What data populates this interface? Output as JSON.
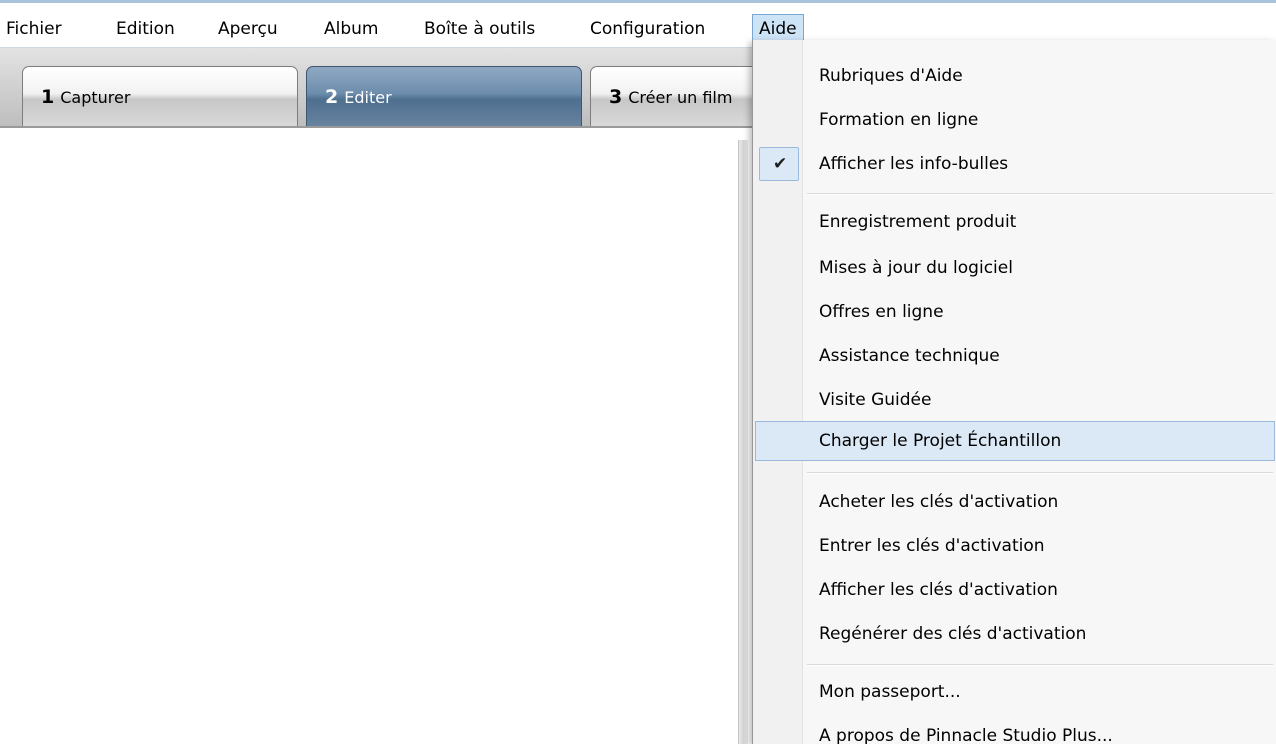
{
  "menubar": {
    "items": [
      {
        "label": "Fichier"
      },
      {
        "label": "Edition"
      },
      {
        "label": "Aperçu"
      },
      {
        "label": "Album"
      },
      {
        "label": "Boîte à outils"
      },
      {
        "label": "Configuration"
      },
      {
        "label": "Aide"
      }
    ],
    "open_menu": "Aide"
  },
  "tabs": [
    {
      "num": "1",
      "label": "Capturer",
      "active": false
    },
    {
      "num": "2",
      "label": "Editer",
      "active": true
    },
    {
      "num": "3",
      "label": "Créer un film",
      "active": false
    }
  ],
  "aide_menu": {
    "groups": [
      [
        {
          "label": "Rubriques d'Aide"
        },
        {
          "label": "Formation en ligne"
        },
        {
          "label": "Afficher les info-bulles",
          "checked": true
        }
      ],
      [
        {
          "label": "Enregistrement produit"
        },
        {
          "label": "Mises à jour du logiciel"
        },
        {
          "label": "Offres en ligne"
        },
        {
          "label": "Assistance technique"
        },
        {
          "label": "Visite Guidée"
        },
        {
          "label": "Charger le Projet Échantillon",
          "highlighted": true
        }
      ],
      [
        {
          "label": "Acheter les clés d'activation"
        },
        {
          "label": "Entrer les clés d'activation"
        },
        {
          "label": "Afficher les clés d'activation"
        },
        {
          "label": "Regénérer des clés d'activation"
        }
      ],
      [
        {
          "label": "Mon passeport..."
        },
        {
          "label": "A propos de Pinnacle Studio Plus..."
        }
      ]
    ]
  },
  "colors": {
    "highlight_bg": "#dbe8f5",
    "highlight_border": "#9ab9dc",
    "active_tab": "#5b7b9b"
  },
  "icons": {
    "checkmark": "check-icon"
  }
}
